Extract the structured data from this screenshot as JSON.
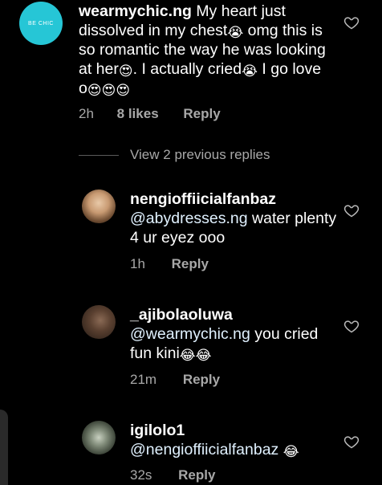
{
  "main_comment": {
    "avatar_text": "BE CHIC",
    "username": "wearmychic.ng",
    "text_1": "My heart just dissolved in my chest",
    "text_2": "omg this is so romantic the way he was looking at her",
    "text_3": ". I actually cried",
    "text_4": "I go love o",
    "time": "2h",
    "likes": "8 likes",
    "reply": "Reply"
  },
  "view_previous": "View 2 previous replies",
  "replies": [
    {
      "username": "nengioffiicialfanbaz",
      "mention": "@abydresses.ng",
      "text": "water plenty 4 ur eyez ooo",
      "time": "1h",
      "reply": "Reply"
    },
    {
      "username": "_ajibolaoluwa",
      "mention": "@wearmychic.ng",
      "text": "you cried fun kini",
      "time": "21m",
      "reply": "Reply"
    },
    {
      "username": "igilolo1",
      "mention": "@nengioffiicialfanbaz",
      "text": "",
      "time": "32s",
      "reply": "Reply"
    }
  ],
  "icons": {
    "heart": "heart-outline-icon",
    "crying": "loudly-crying-face-emoji",
    "heart_eyes": "heart-eyes-emoji",
    "laughing": "tears-of-joy-emoji"
  },
  "colors": {
    "background": "#000000",
    "text": "#ffffff",
    "meta": "#a8a8a8",
    "avatar_brand": "#26c6d6"
  }
}
